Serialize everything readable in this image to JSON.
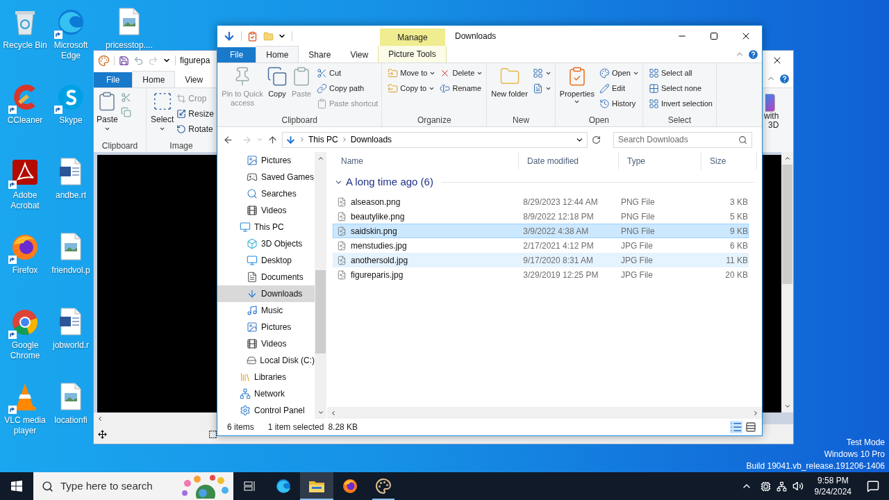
{
  "desktop": {
    "icons": [
      {
        "label": "Recycle Bin",
        "shortcut": false
      },
      {
        "label": "CCleaner",
        "shortcut": true
      },
      {
        "label": "Adobe Acrobat",
        "shortcut": true
      },
      {
        "label": "Firefox",
        "shortcut": true
      },
      {
        "label": "Google Chrome",
        "shortcut": true
      },
      {
        "label": "VLC media player",
        "shortcut": true
      },
      {
        "label": "Microsoft Edge",
        "shortcut": true
      },
      {
        "label": "Skype",
        "shortcut": true
      },
      {
        "label": "andbe.rt",
        "shortcut": false
      },
      {
        "label": "friendvol.p",
        "shortcut": false
      },
      {
        "label": "jobworld.r",
        "shortcut": false
      },
      {
        "label": "locationfi",
        "shortcut": false
      },
      {
        "label": "pricesstop....",
        "shortcut": false
      }
    ],
    "watermark_lines": [
      "Test Mode",
      "Windows 10 Pro",
      "Build 19041.vb_release.191206-1406"
    ]
  },
  "paint": {
    "title": "figurepa",
    "tabs": [
      {
        "label": "File",
        "selected": false,
        "kind": "file"
      },
      {
        "label": "Home",
        "selected": true,
        "kind": "tab"
      },
      {
        "label": "View",
        "selected": false,
        "kind": "tab"
      }
    ],
    "paste": "Paste",
    "clipboard_label": "Clipboard",
    "select": "Select",
    "image_tools": [
      {
        "label": "Crop",
        "disabled": true
      },
      {
        "label": "Resize",
        "disabled": false
      },
      {
        "label": "Rotate",
        "disabled": false
      }
    ],
    "image_label": "Image",
    "partial_button": [
      "with",
      "3D"
    ]
  },
  "explorer": {
    "title": "Downloads",
    "context_tab": "Manage",
    "tabs": [
      {
        "label": "File",
        "selected": false,
        "kind": "file"
      },
      {
        "label": "Home",
        "selected": true,
        "kind": "tab"
      },
      {
        "label": "Share",
        "selected": false,
        "kind": "tab"
      },
      {
        "label": "View",
        "selected": false,
        "kind": "tab"
      },
      {
        "label": "Picture Tools",
        "selected": false,
        "kind": "context"
      }
    ],
    "ribbon": [
      {
        "label": "Clipboard",
        "columns": [
          [
            {
              "label": "Pin to Quick access",
              "kind": "large",
              "disabled": true,
              "menu": false
            }
          ],
          [
            {
              "label": "Copy",
              "kind": "large",
              "disabled": false,
              "menu": false
            }
          ],
          [
            {
              "label": "Paste",
              "kind": "large",
              "disabled": true,
              "menu": false
            }
          ],
          [
            {
              "label": "Cut",
              "kind": "small",
              "disabled": false,
              "menu": false
            },
            {
              "label": "Copy path",
              "kind": "small",
              "disabled": false,
              "menu": false
            },
            {
              "label": "Paste shortcut",
              "kind": "small",
              "disabled": true,
              "menu": false
            }
          ]
        ]
      },
      {
        "label": "Organize",
        "columns": [
          [
            {
              "label": "Move to",
              "kind": "small",
              "disabled": false,
              "menu": true
            },
            {
              "label": "Copy to",
              "kind": "small",
              "disabled": false,
              "menu": true
            }
          ],
          [
            {
              "label": "Delete",
              "kind": "small",
              "disabled": false,
              "menu": true
            },
            {
              "label": "Rename",
              "kind": "small",
              "disabled": false,
              "menu": false
            }
          ]
        ]
      },
      {
        "label": "New",
        "columns": [
          [
            {
              "label": "New folder",
              "kind": "large",
              "disabled": false,
              "menu": false
            }
          ],
          [
            {
              "kind": "icon",
              "disabled": false,
              "menu": true
            },
            {
              "kind": "icon",
              "disabled": false,
              "menu": true
            }
          ]
        ]
      },
      {
        "label": "Open",
        "columns": [
          [
            {
              "label": "Properties",
              "kind": "large",
              "disabled": false,
              "menu": true
            }
          ],
          [
            {
              "label": "Open",
              "kind": "small",
              "disabled": false,
              "menu": true
            },
            {
              "label": "Edit",
              "kind": "small",
              "disabled": false,
              "menu": false
            },
            {
              "label": "History",
              "kind": "small",
              "disabled": false,
              "menu": false
            }
          ]
        ]
      },
      {
        "label": "Select",
        "columns": [
          [
            {
              "label": "Select all",
              "kind": "small",
              "disabled": false,
              "menu": false
            },
            {
              "label": "Select none",
              "kind": "small",
              "disabled": false,
              "menu": false
            },
            {
              "label": "Invert selection",
              "kind": "small",
              "disabled": false,
              "menu": false
            }
          ]
        ]
      }
    ],
    "address": [
      "This PC",
      "Downloads"
    ],
    "search": {
      "placeholder": "Search Downloads"
    },
    "nav": [
      {
        "children": [
          {
            "label": "Pictures",
            "kind": "pictures",
            "selected": false
          },
          {
            "label": "Saved Games",
            "kind": "games",
            "selected": false
          },
          {
            "label": "Searches",
            "kind": "search",
            "selected": false
          },
          {
            "label": "Videos",
            "kind": "videos",
            "selected": false
          }
        ]
      },
      {
        "label": "This PC",
        "kind": "pc",
        "selected": false,
        "children": [
          {
            "label": "3D Objects",
            "kind": "cube",
            "selected": false
          },
          {
            "label": "Desktop",
            "kind": "desktop",
            "selected": false
          },
          {
            "label": "Documents",
            "kind": "documents",
            "selected": false
          },
          {
            "label": "Downloads",
            "kind": "downloads",
            "selected": true
          },
          {
            "label": "Music",
            "kind": "music",
            "selected": false
          },
          {
            "label": "Pictures",
            "kind": "pictures",
            "selected": false
          },
          {
            "label": "Videos",
            "kind": "videos",
            "selected": false
          },
          {
            "label": "Local Disk (C:)",
            "kind": "disk",
            "selected": false
          }
        ]
      },
      {
        "label": "Libraries",
        "kind": "libraries",
        "selected": false
      },
      {
        "label": "Network",
        "kind": "network",
        "selected": false
      },
      {
        "label": "Control Panel",
        "kind": "control",
        "selected": false
      }
    ],
    "columns": [
      "Name",
      "Date modified",
      "Type",
      "Size"
    ],
    "group": "A long time ago (6)",
    "files": [
      {
        "name": "alseason.png",
        "date": "8/29/2023 12:44 AM",
        "type": "PNG File",
        "size": "3 KB",
        "selected": false,
        "hovered": false
      },
      {
        "name": "beautylike.png",
        "date": "8/9/2022 12:18 PM",
        "type": "PNG File",
        "size": "5 KB",
        "selected": false,
        "hovered": false
      },
      {
        "name": "saidskin.png",
        "date": "3/9/2022 4:38 AM",
        "type": "PNG File",
        "size": "9 KB",
        "selected": true,
        "hovered": false
      },
      {
        "name": "menstudies.jpg",
        "date": "2/17/2021 4:12 PM",
        "type": "JPG File",
        "size": "6 KB",
        "selected": false,
        "hovered": false
      },
      {
        "name": "anothersold.jpg",
        "date": "9/17/2020 8:31 AM",
        "type": "JPG File",
        "size": "11 KB",
        "selected": false,
        "hovered": true
      },
      {
        "name": "figureparis.jpg",
        "date": "3/29/2019 12:25 PM",
        "type": "JPG File",
        "size": "20 KB",
        "selected": false,
        "hovered": false
      }
    ],
    "status": {
      "count": "6 items",
      "selected": "1 item selected",
      "size": "8.28 KB"
    }
  },
  "taskbar": {
    "search": {
      "placeholder": "Type here to search"
    },
    "apps": [
      {
        "kind": "taskview",
        "active": false,
        "running": false
      },
      {
        "kind": "edge",
        "active": false,
        "running": false
      },
      {
        "kind": "explorer",
        "active": true,
        "running": true
      },
      {
        "kind": "firefox",
        "active": false,
        "running": false
      },
      {
        "kind": "paint",
        "active": false,
        "running": true
      }
    ],
    "time": "9:58 PM",
    "date": "9/24/2024"
  }
}
